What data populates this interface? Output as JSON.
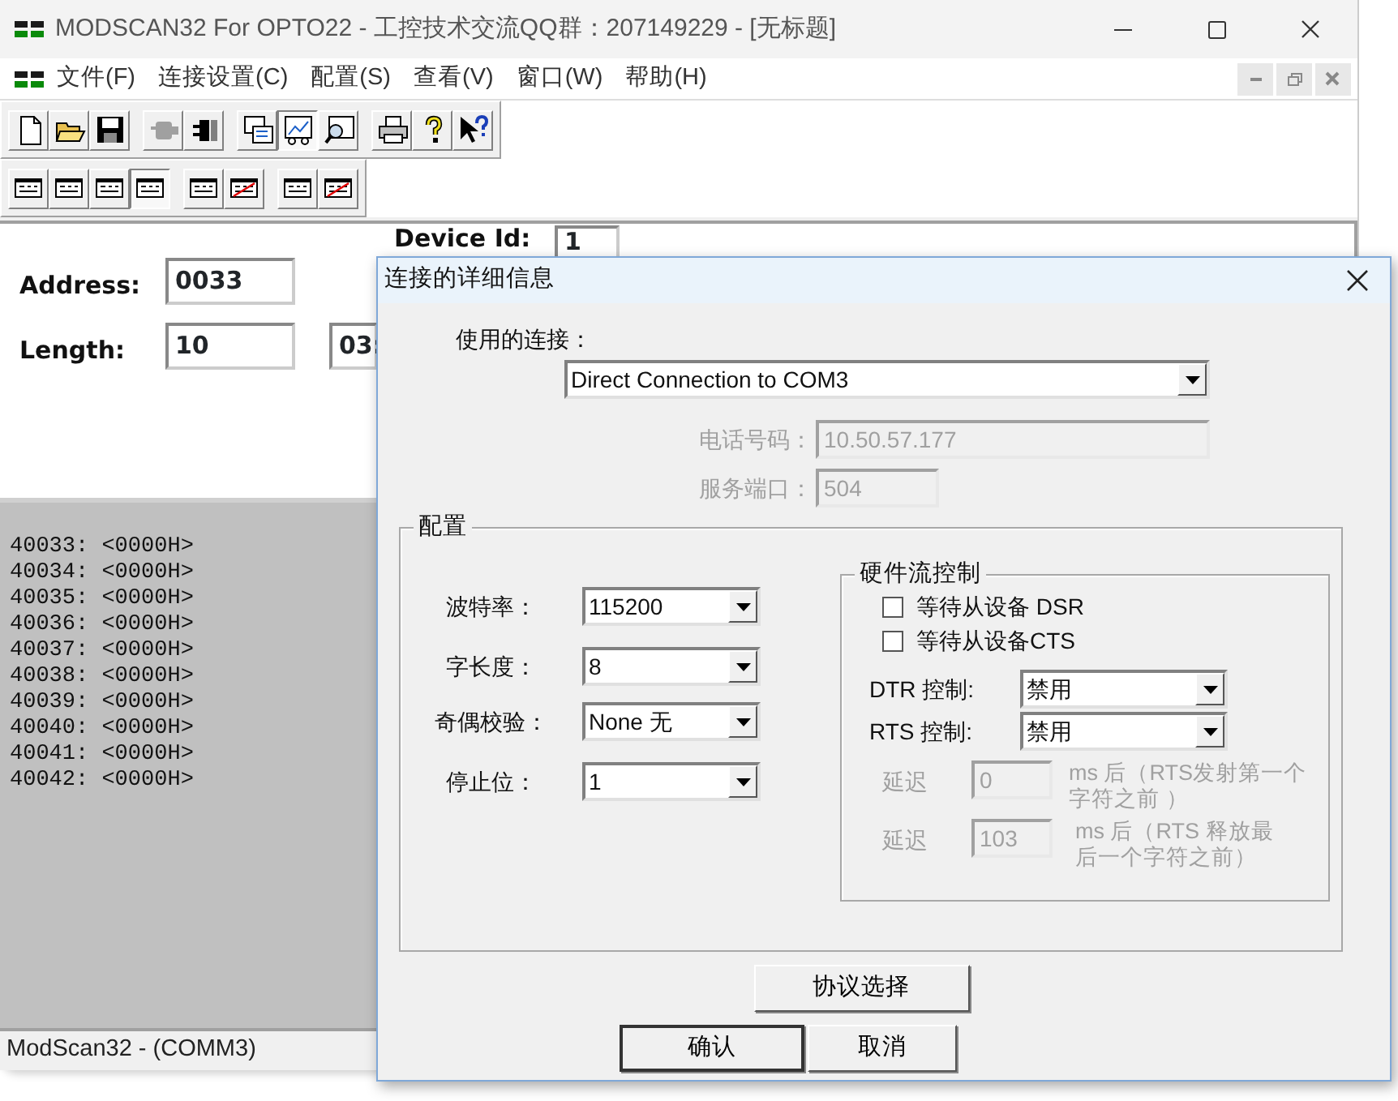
{
  "window": {
    "title": "MODSCAN32 For OPTO22 - 工控技术交流QQ群：207149229 - [无标题]"
  },
  "menu": [
    "文件(F)",
    "连接设置(C)",
    "配置(S)",
    "查看(V)",
    "窗口(W)",
    "帮助(H)"
  ],
  "toolbar": [
    [
      {
        "kind": "new",
        "selected": false,
        "disabled": false
      },
      {
        "kind": "open",
        "selected": false,
        "disabled": false
      },
      {
        "kind": "save",
        "selected": false,
        "disabled": false
      }
    ],
    [
      {
        "kind": "connect",
        "selected": false,
        "disabled": true
      },
      {
        "kind": "disconnect",
        "selected": false,
        "disabled": false
      }
    ],
    [
      {
        "kind": "tree",
        "selected": false,
        "disabled": false
      },
      {
        "kind": "chart",
        "selected": true,
        "disabled": false
      },
      {
        "kind": "inspect",
        "selected": false,
        "disabled": false
      }
    ],
    [
      {
        "kind": "print",
        "selected": false,
        "disabled": false
      },
      {
        "kind": "help",
        "selected": false,
        "disabled": false
      },
      {
        "kind": "context-help",
        "selected": false,
        "disabled": false
      }
    ]
  ],
  "format_toolbar": [
    [
      {
        "kind": "format",
        "selected": false
      },
      {
        "kind": "format",
        "selected": false
      },
      {
        "kind": "format",
        "selected": false
      },
      {
        "kind": "format",
        "selected": true
      }
    ],
    [
      {
        "kind": "format",
        "selected": false
      },
      {
        "kind": "format-swapped",
        "selected": false
      }
    ],
    [
      {
        "kind": "format",
        "selected": false
      },
      {
        "kind": "format-swapped",
        "selected": false
      }
    ]
  ],
  "scan": {
    "address_label": "Address:",
    "address": "0033",
    "length_label": "Length:",
    "length": "10",
    "type_partial": "03:",
    "device_id_label": "Device Id:",
    "device_id": "1"
  },
  "registers": [
    "40033: <0000H>",
    "40034: <0000H>",
    "40035: <0000H>",
    "40036: <0000H>",
    "40037: <0000H>",
    "40038: <0000H>",
    "40039: <0000H>",
    "40040: <0000H>",
    "40041: <0000H>",
    "40042: <0000H>"
  ],
  "status_bar": "ModScan32 - (COMM3)",
  "dialog": {
    "title": "连接的详细信息",
    "connection_label": "使用的连接：",
    "connection": "Direct Connection to COM3",
    "remote": [
      {
        "label": "电话号码：",
        "value": "10.50.57.177",
        "disabled": true
      },
      {
        "label": "服务端口：",
        "value": "504",
        "disabled": true
      }
    ],
    "config": {
      "title": "配置",
      "settings": [
        {
          "label": "波特率：",
          "value": "115200"
        },
        {
          "label": "字长度：",
          "value": "8"
        },
        {
          "label": "奇偶校验：",
          "value": "None 无"
        },
        {
          "label": "停止位：",
          "value": "1"
        }
      ],
      "flow_control": {
        "title": "硬件流控制",
        "checks": [
          {
            "label": "等待从设备 DSR",
            "checked": false
          },
          {
            "label": "等待从设备CTS",
            "checked": false
          }
        ],
        "controls": [
          {
            "label": "DTR 控制:",
            "value": "禁用"
          },
          {
            "label": "RTS 控制:",
            "value": "禁用"
          }
        ],
        "delays": [
          {
            "label": "延迟",
            "value": "0",
            "note": "ms 后（RTS发射第一个字符之前 ）",
            "disabled": true
          },
          {
            "label": "延迟",
            "value": "103",
            "note": "ms 后（RTS 释放最后一个字符之前）",
            "disabled": true
          }
        ]
      }
    },
    "buttons": [
      "协议选择",
      "确认",
      "取消"
    ]
  }
}
